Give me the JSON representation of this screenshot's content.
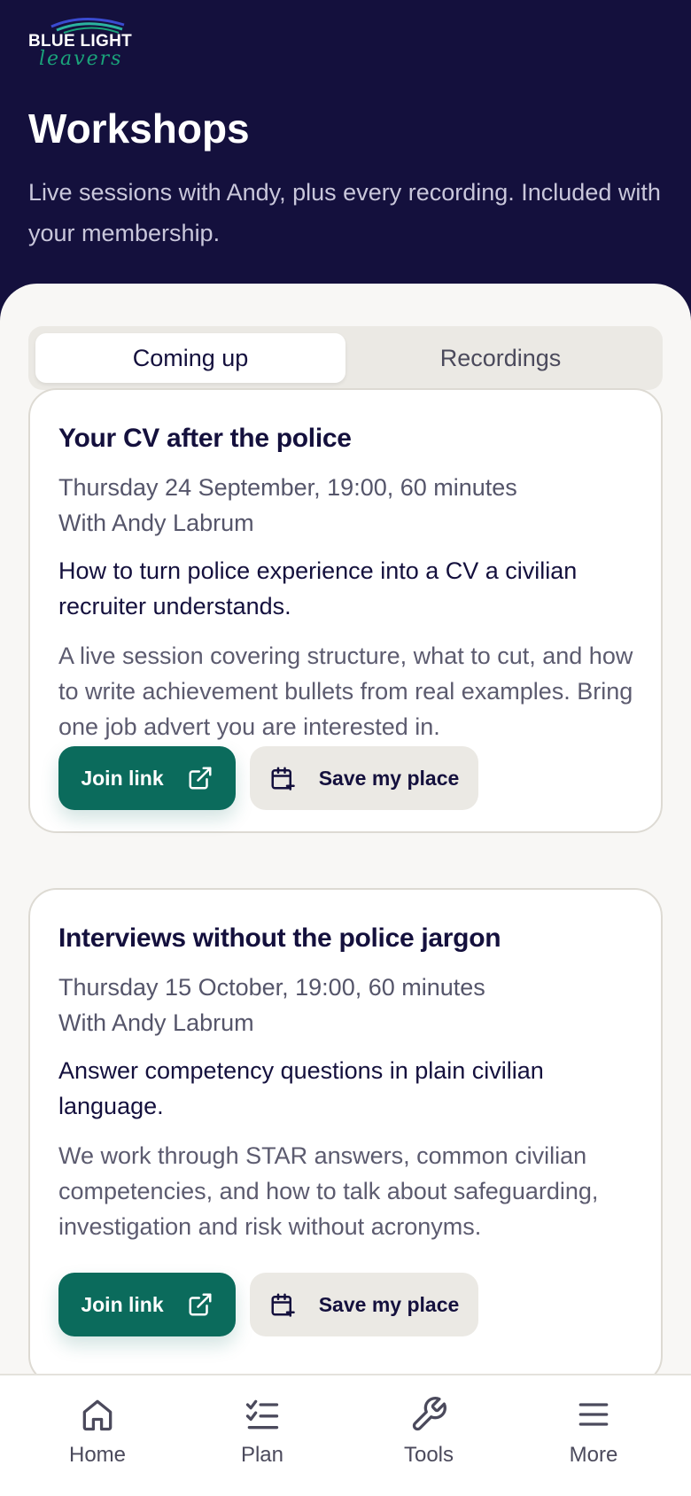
{
  "brand": {
    "logo_top": "BLUE LIGHT",
    "logo_bottom": "leavers"
  },
  "page": {
    "title": "Workshops",
    "subtitle": "Live sessions with Andy, plus every recording. Included with your membership."
  },
  "tabs": [
    {
      "label": "Coming up",
      "active": true
    },
    {
      "label": "Recordings",
      "active": false
    }
  ],
  "workshops": [
    {
      "title": "Your CV after the police",
      "when": "Thursday 24 September, 19:00, 60 minutes",
      "host": "With Andy Labrum",
      "lead": "How to turn police experience into a CV a civilian recruiter understands.",
      "description": "A live session covering structure, what to cut, and how to write achievement bullets from real examples. Bring one job advert you are interested in.",
      "join_label": "Join link",
      "save_label": "Save my place"
    },
    {
      "title": "Interviews without the police jargon",
      "when": "Thursday 15 October, 19:00, 60 minutes",
      "host": "With Andy Labrum",
      "lead": "Answer competency questions in plain civilian language.",
      "description": "We work through STAR answers, common civilian competencies, and how to talk about safeguarding, investigation and risk without acronyms.",
      "join_label": "Join link",
      "save_label": "Save my place"
    }
  ],
  "nav": [
    {
      "label": "Home",
      "icon": "home-icon"
    },
    {
      "label": "Plan",
      "icon": "checklist-icon"
    },
    {
      "label": "Tools",
      "icon": "wrench-icon"
    },
    {
      "label": "More",
      "icon": "menu-icon"
    }
  ],
  "colors": {
    "header_bg": "#14103d",
    "accent": "#0b6b5c",
    "sheet_bg": "#f8f7f5",
    "logo_green": "#1aa37a"
  }
}
